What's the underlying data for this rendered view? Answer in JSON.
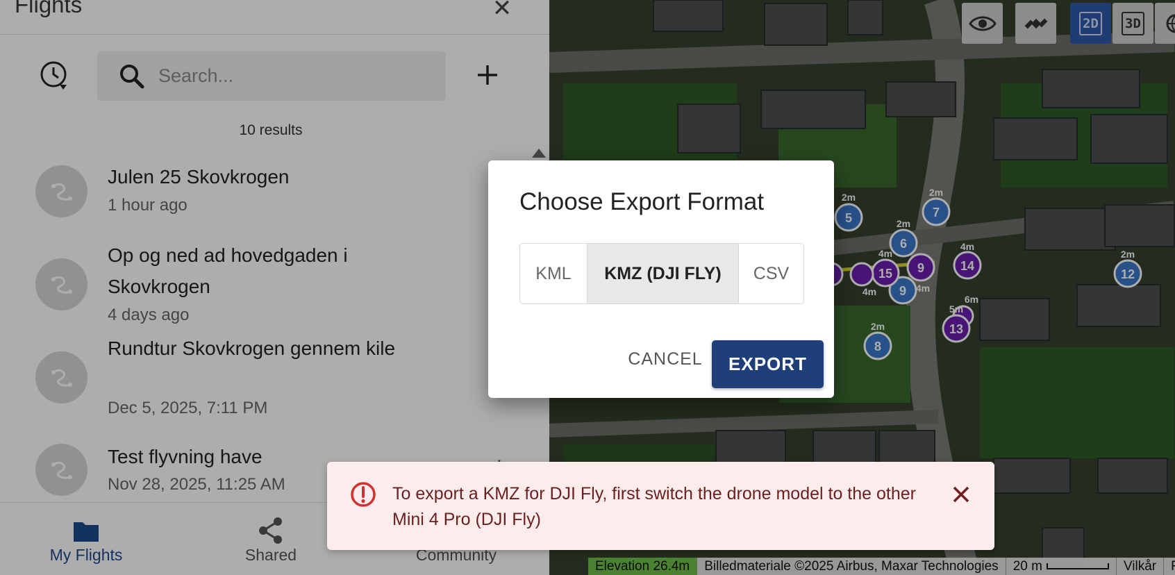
{
  "panel": {
    "title": "Flights",
    "close_icon": "close-icon",
    "search": {
      "placeholder": "Search..."
    },
    "results_count": "10 results",
    "flights": [
      {
        "name": "Julen 25 Skovkrogen",
        "date": "1 hour ago"
      },
      {
        "name": "Op og ned ad hovedgaden i Skovkrogen",
        "date": "4 days ago"
      },
      {
        "name": "Rundtur Skovkrogen gennem kile",
        "date": "Dec 5, 2025, 7:11 PM"
      },
      {
        "name": "Test flyvning have",
        "date": "Nov 28, 2025, 11:25 AM"
      }
    ]
  },
  "bottom_nav": {
    "tabs": [
      {
        "label": "My Flights",
        "icon": "folder-icon",
        "active": true
      },
      {
        "label": "Shared",
        "icon": "share-icon",
        "active": false
      },
      {
        "label": "Community",
        "icon": "community-icon",
        "active": false
      }
    ]
  },
  "map": {
    "controls": {
      "mode_2d": "2D",
      "mode_3d": "3D"
    },
    "waypoint_labels": [
      "2m",
      "5",
      "2m",
      "7",
      "2m",
      "6",
      "4m",
      "15",
      "9",
      "4m",
      "14",
      "2m",
      "12",
      "4m",
      "9",
      "4m",
      "5m",
      "6m",
      "13",
      "2m",
      "8"
    ],
    "footer": {
      "elevation": "Elevation 26.4m",
      "attribution": "Billedmateriale ©2025 Airbus, Maxar Technologies",
      "scale": "20 m",
      "terms": "Vilkår",
      "extra": "F"
    }
  },
  "dialog": {
    "title": "Choose Export Format",
    "formats": [
      "KML",
      "KMZ (DJI FLY)",
      "CSV"
    ],
    "selected_format": "KMZ (DJI FLY)",
    "cancel_label": "CANCEL",
    "export_label": "EXPORT"
  },
  "toast": {
    "message": "To export a KMZ for DJI Fly, first switch the drone model to the other Mini 4 Pro (DJI Fly)",
    "color": "#d32f2f"
  },
  "colors": {
    "accent": "#1e3f7a",
    "nav_active": "#1e4a8c",
    "waypoint_blue": "#3a78c9",
    "waypoint_purple": "#6a1fb0"
  }
}
